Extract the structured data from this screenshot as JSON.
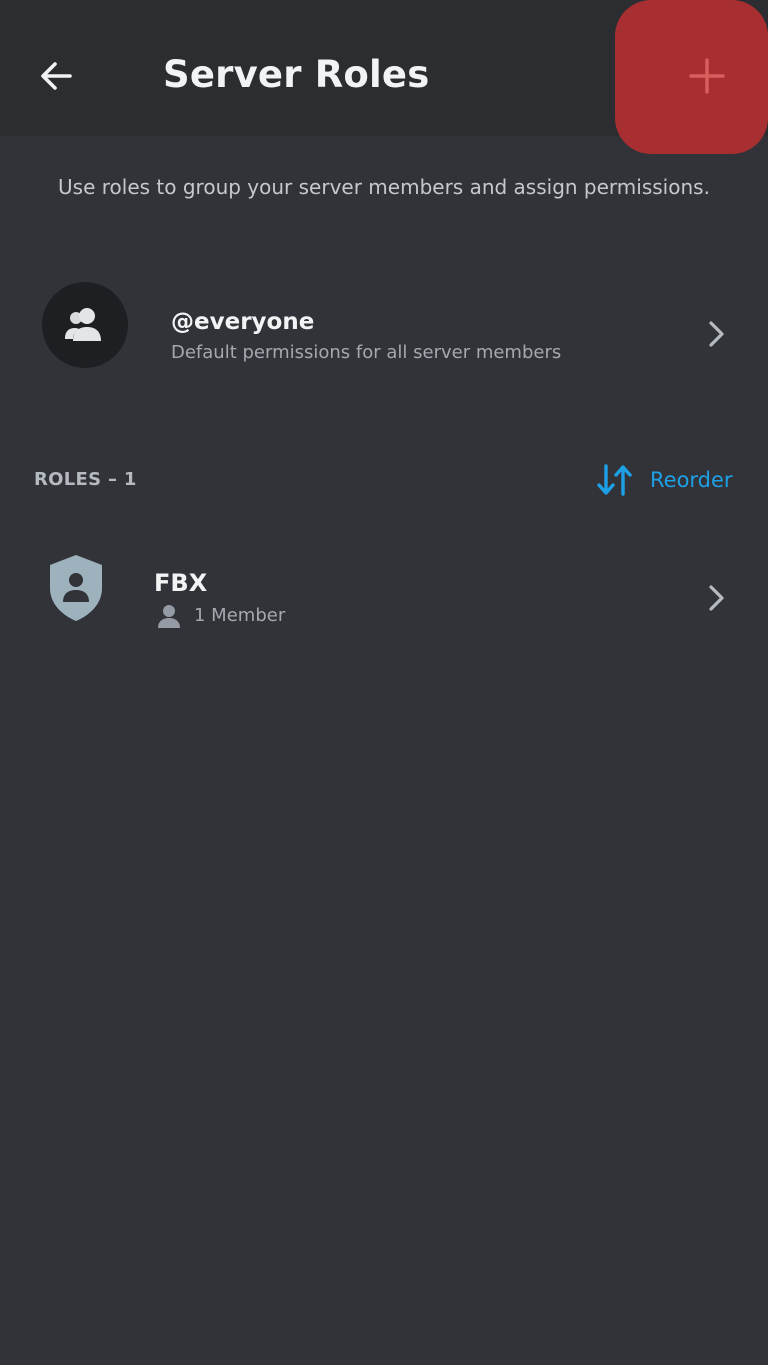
{
  "header": {
    "title": "Server Roles",
    "back_icon": "arrow-left-icon",
    "add_icon": "plus-icon"
  },
  "subtitle": "Use roles to group your server members and assign permissions.",
  "everyone": {
    "name": "@everyone",
    "description": "Default permissions for all server members",
    "icon": "people-icon"
  },
  "roles_section": {
    "header": "ROLES – 1",
    "reorder_label": "Reorder",
    "reorder_icon": "swap-vertical-icon"
  },
  "roles": [
    {
      "name": "FBX",
      "members_label": "1 Member",
      "icon": "shield-user-icon",
      "color": "#9eb2bd"
    }
  ],
  "colors": {
    "background": "#313338",
    "header": "#2b2d31",
    "accent_red": "#a72e31",
    "link_blue": "#1ea0e6"
  }
}
